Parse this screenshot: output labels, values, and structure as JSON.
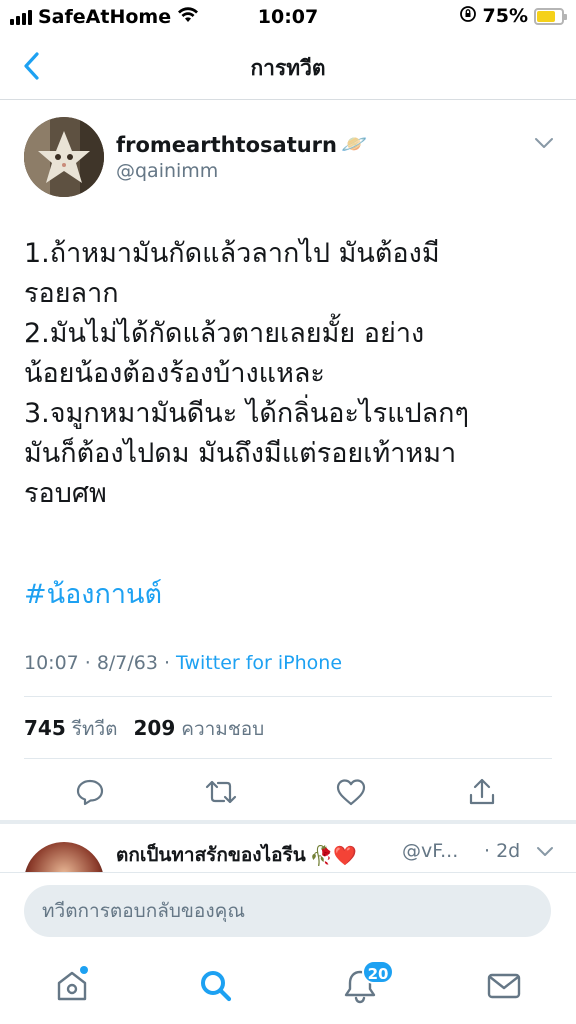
{
  "status_bar": {
    "carrier": "SafeAtHome",
    "time": "10:07",
    "battery_percent": "75%",
    "battery_level": 0.75,
    "battery_color": "#f5d11a"
  },
  "nav": {
    "title": "การทวีต",
    "back_icon": "chevron-left-icon"
  },
  "tweet": {
    "display_name": "fromearthtosaturn",
    "name_emoji": "🪐",
    "handle": "@qainimm",
    "text": "1.ถ้าหมามันกัดแล้วลากไป มันต้องมี\nรอยลาก\n2.มันไม่ได้กัดแล้วตายเลยมั้ย อย่าง\nน้อยน้องต้องร้องบ้างแหละ\n3.จมูกหมามันดีนะ ได้กลิ่นอะไรแปลกๆ\nมันก็ต้องไปดม มันถึงมีแต่รอยเท้าหมา\nรอบศพ",
    "hashtag": "#น้องกานต์",
    "time": "10:07",
    "date": "8/7/63",
    "separator": "·",
    "source": "Twitter for iPhone",
    "retweet_count": "745",
    "retweet_label": "รีทวีต",
    "like_count": "209",
    "like_label": "ความชอบ",
    "accent_color": "#1da1f2"
  },
  "reply_preview": {
    "display_name": "ตกเป็นทาสรักของไอรีน",
    "name_emoji": "🥀❤️",
    "handle": "@vF...",
    "time": "· 2d"
  },
  "reply_bar": {
    "placeholder": "ทวีตการตอบกลับของคุณ"
  },
  "tab_bar": {
    "notifications_badge": "20",
    "items": [
      "home-icon",
      "search-icon",
      "notifications-icon",
      "messages-icon"
    ]
  }
}
